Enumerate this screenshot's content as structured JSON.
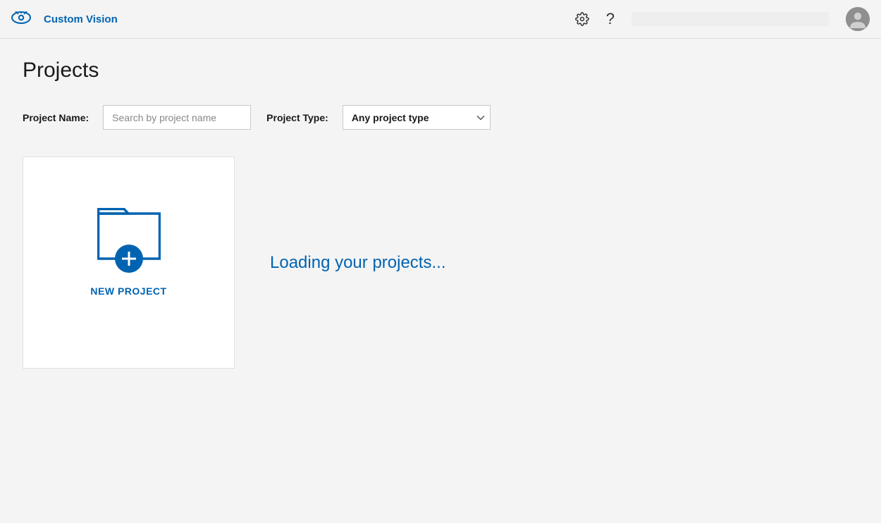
{
  "header": {
    "app_title": "Custom Vision"
  },
  "main": {
    "page_title": "Projects",
    "filters": {
      "project_name_label": "Project Name:",
      "project_name_placeholder": "Search by project name",
      "project_type_label": "Project Type:",
      "project_type_selected": "Any project type",
      "project_type_options": [
        "Any project type"
      ]
    },
    "new_project_label": "NEW PROJECT",
    "loading_text": "Loading your projects..."
  },
  "colors": {
    "accent": "#0063b1",
    "background": "#f4f4f4"
  }
}
